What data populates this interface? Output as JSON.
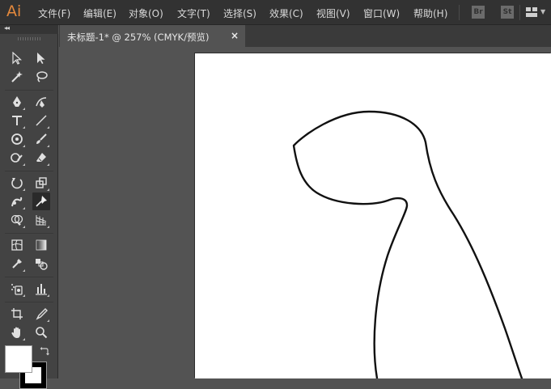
{
  "app": {
    "logo": "Ai"
  },
  "menu": {
    "items": [
      "文件(F)",
      "编辑(E)",
      "对象(O)",
      "文字(T)",
      "选择(S)",
      "效果(C)",
      "视图(V)",
      "窗口(W)",
      "帮助(H)"
    ]
  },
  "bridge_badge": "Br",
  "stock_badge": "St",
  "tools_panel": {
    "collapse_label": "◂◂",
    "tools": [
      "selection-tool",
      "direct-selection-tool",
      "magic-wand-tool",
      "lasso-tool",
      "pen-tool",
      "curvature-tool",
      "type-tool",
      "line-segment-tool",
      "ellipse-tool",
      "paintbrush-tool",
      "shaper-tool",
      "eraser-tool",
      "rotate-tool",
      "scale-tool",
      "warp-tool",
      "puppet-warp-tool",
      "shape-builder-tool",
      "perspective-grid-tool",
      "mesh-tool",
      "gradient-tool",
      "eyedropper-tool",
      "blend-tool",
      "symbol-sprayer-tool",
      "column-graph-tool",
      "artboard-tool",
      "slice-tool",
      "hand-tool",
      "zoom-tool"
    ],
    "active_tool": "puppet-warp-tool",
    "fill_color": "#ffffff",
    "stroke_color": "#000000"
  },
  "document": {
    "tab_title": "未标题-1* @ 257% (CMYK/预览)",
    "close_glyph": "×"
  },
  "colors": {
    "menubar_bg": "#323232",
    "panel_bg": "#434343",
    "canvas_bg": "#535353",
    "logo_accent": "#e3883c"
  }
}
